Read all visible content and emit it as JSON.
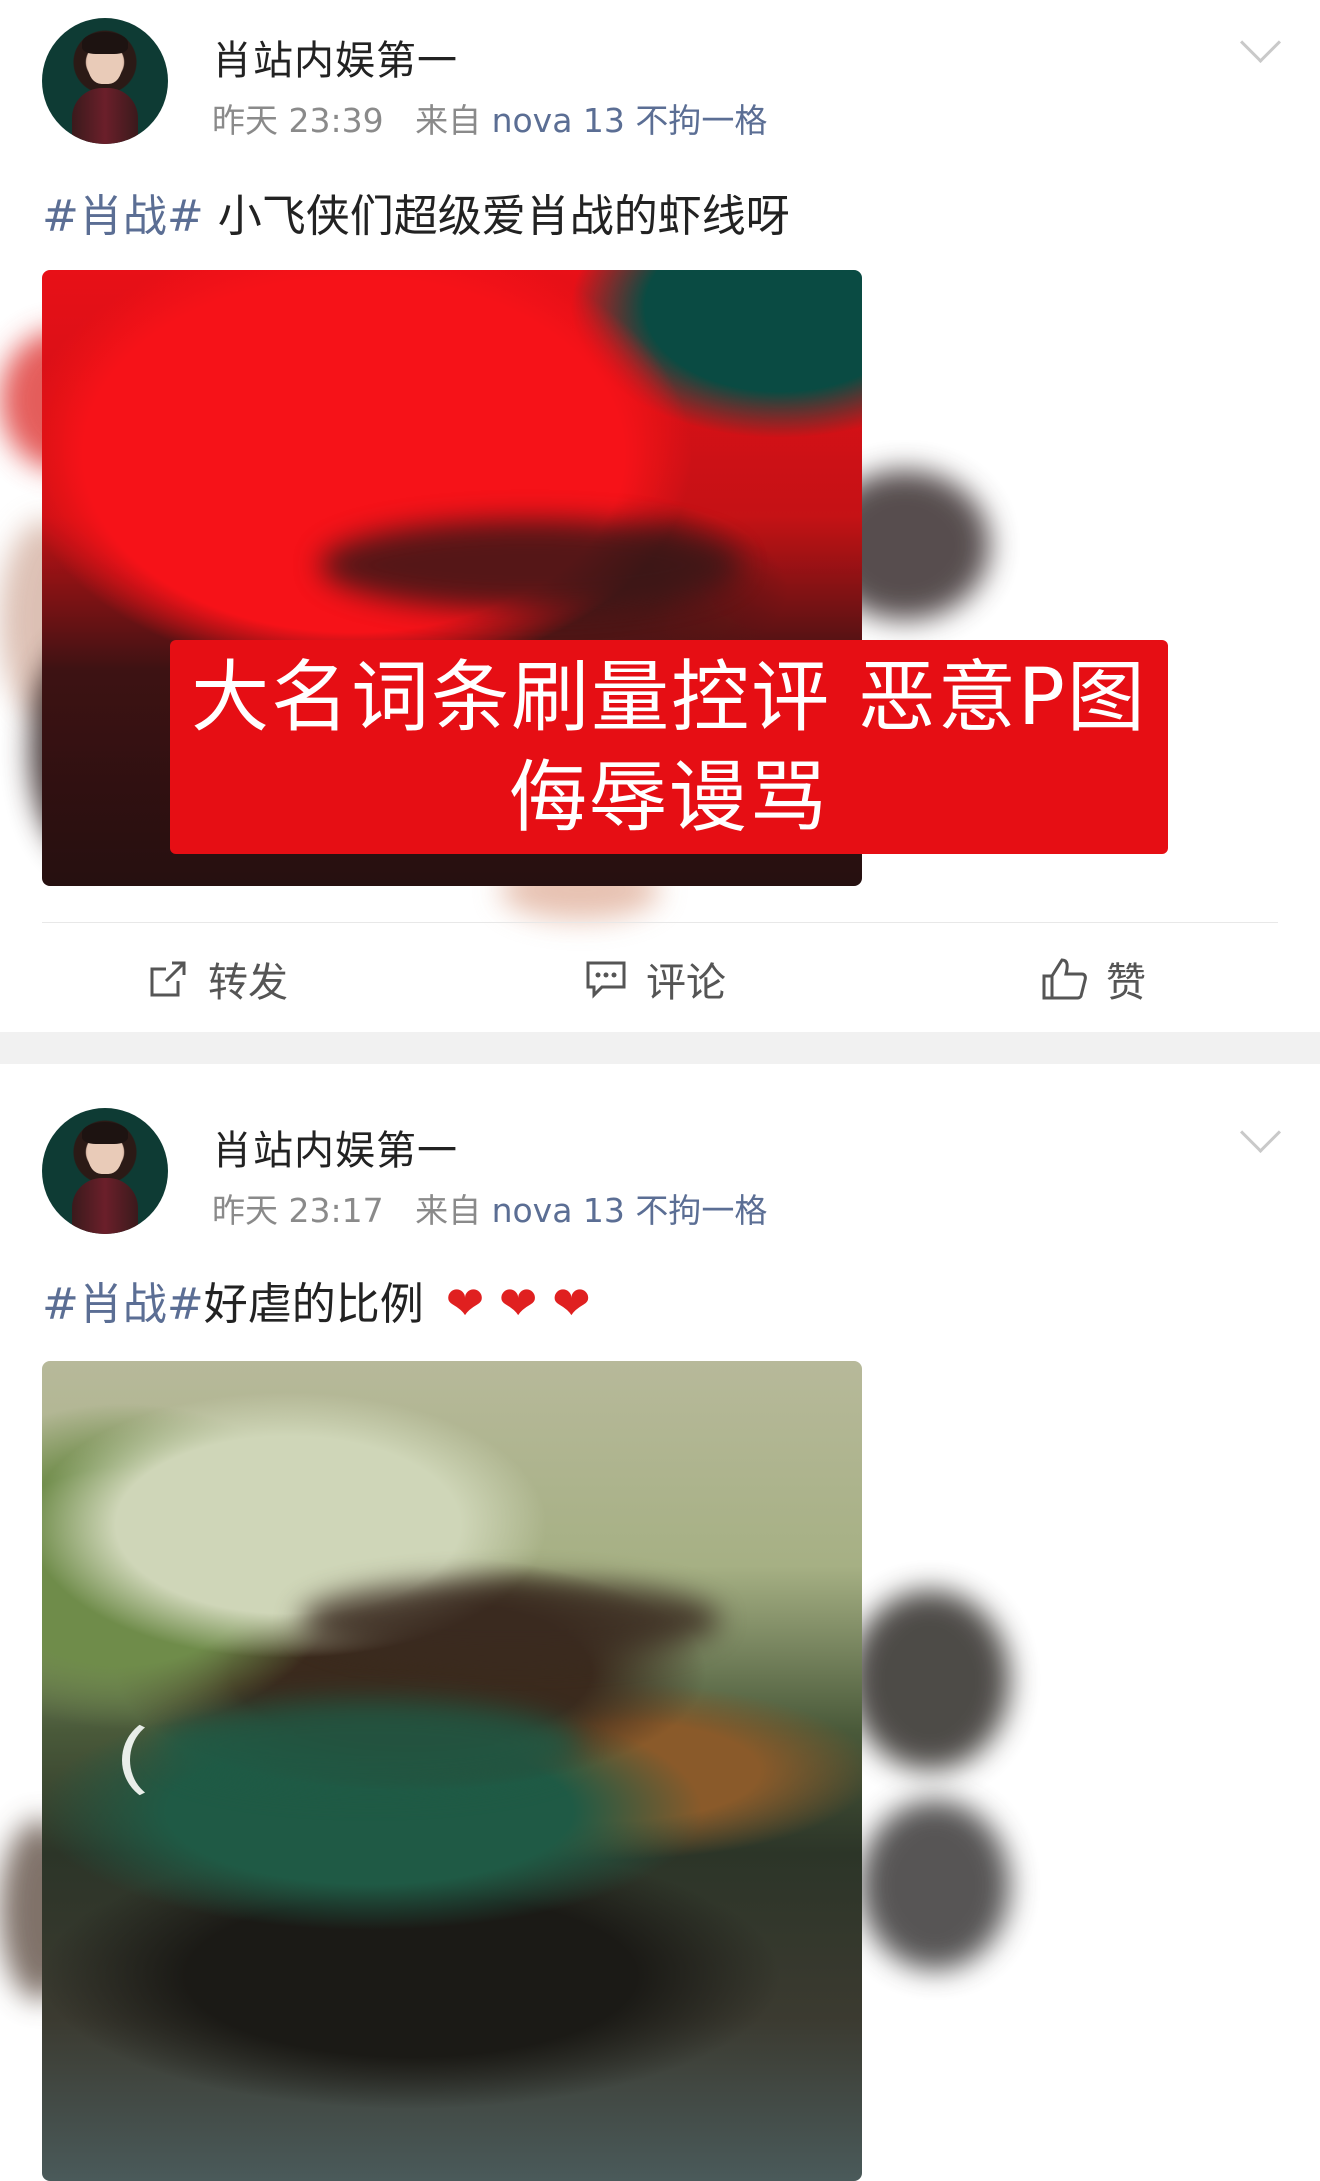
{
  "posts": [
    {
      "username": "肖站内娱第一",
      "time": "昨天 23:39",
      "source_prefix": "来自",
      "device": "nova 13 不拘一格",
      "tag": "#肖战#",
      "text": " 小飞侠们超级爱肖战的虾线呀",
      "banner_line1": "大名词条刷量控评 恶意P图",
      "banner_line2": "侮辱谩骂",
      "actions": {
        "repost": "转发",
        "comment": "评论",
        "like": "赞"
      }
    },
    {
      "username": "肖站内娱第一",
      "time": "昨天 23:17",
      "source_prefix": "来自",
      "device": "nova 13 不拘一格",
      "tag": "#肖战#",
      "text": "好虐的比例",
      "hearts": "❤ ❤ ❤"
    }
  ],
  "colors": {
    "link": "#5b6e94",
    "banner": "#e60e14",
    "heart": "#e02020"
  },
  "icons": [
    "dropdown-chevron-icon",
    "repost-icon",
    "comment-icon",
    "like-icon"
  ]
}
